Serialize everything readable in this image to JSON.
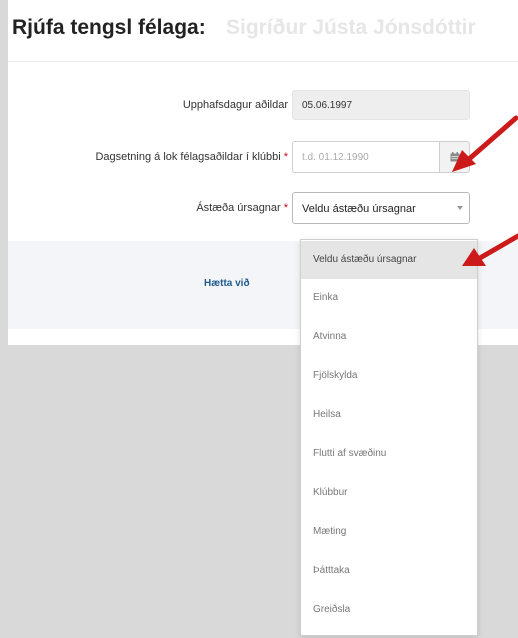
{
  "dialog": {
    "title": "Rjúfa tengsl félaga:",
    "member_name": "Sigríður Jústa Jónsdóttir"
  },
  "form": {
    "start_date_label": "Upphafsdagur aðildar",
    "start_date_value": "05.06.1997",
    "end_date_label": "Dagsetning á lok félagsaðildar í klúbbi",
    "end_date_placeholder": "t.d. 01.12.1990",
    "reason_label": "Ástæða úrsagnar",
    "reason_value": "Veldu ástæðu úrsagnar",
    "required_mark": "*"
  },
  "footer": {
    "cancel_label": "Hætta við"
  },
  "dropdown": {
    "options": [
      "Veldu ástæðu úrsagnar",
      "Einka",
      "Atvinna",
      "Fjölskylda",
      "Heilsa",
      "Flutti af svæðinu",
      "Klúbbur",
      "Mæting",
      "Þátttaka",
      "Greiðsla"
    ]
  },
  "icons": {
    "calendar": "calendar-icon",
    "dropdown_caret": "chevron-down-icon"
  },
  "colors": {
    "required": "#d0021b",
    "link": "#1e5a8c",
    "annotation_arrow": "#cc1a1a",
    "backdrop": "#d9d9d9"
  }
}
